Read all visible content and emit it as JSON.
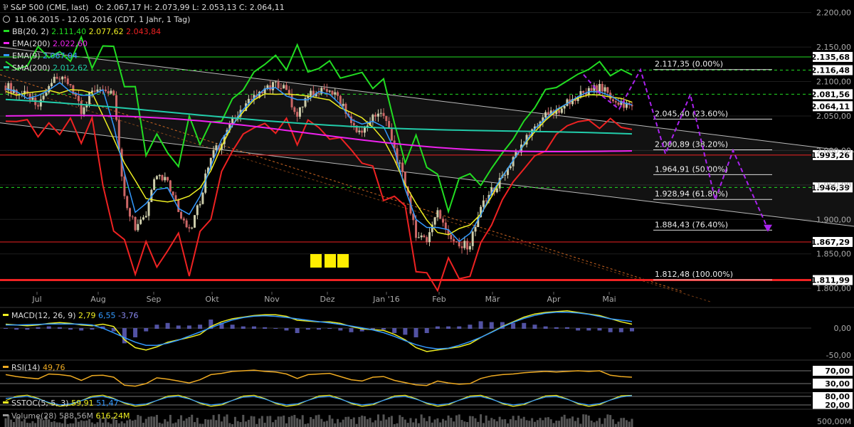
{
  "header": {
    "logo_text": "⅌",
    "title": "S&P 500 (CME, last)",
    "ohlc": "O: 2.067,17  H: 2.073,99  L: 2.053,13  C: 2.064,11",
    "period": "11.06.2015 - 12.05.2016 (CDT, 1 Jahr, 1 Tag)",
    "indicators": [
      {
        "label": "BB(20, 2)",
        "values": [
          "2.111,40",
          "2.077,62",
          "2.043,84"
        ],
        "colors": [
          "#22dd22",
          "#eeee22",
          "#ee2222"
        ],
        "swatch": "#22dd22"
      },
      {
        "label": "EMA(200)",
        "values": [
          "2.022,60"
        ],
        "colors": [
          "#ee22ee"
        ],
        "swatch": "#ee22ee"
      },
      {
        "label": "EMA(9)",
        "values": [
          "2.067,04"
        ],
        "colors": [
          "#3399ff"
        ],
        "swatch": "#3399ff"
      },
      {
        "label": "SMA(200)",
        "values": [
          "2.012,62"
        ],
        "colors": [
          "#22ccaa"
        ],
        "swatch": "#22ccaa"
      }
    ]
  },
  "chart_data": {
    "type": "candlestick",
    "y_range": [
      1795,
      2212
    ],
    "y_ticks": [
      "2.200,00",
      "2.150,00",
      "2.100,00",
      "2.050,00",
      "2.000,00",
      "1.950,00",
      "1.900,00",
      "1.850,00",
      "1.800,00"
    ],
    "y_tick_values": [
      2200,
      2150,
      2100,
      2050,
      2000,
      1950,
      1900,
      1850,
      1800
    ],
    "x_ticks": [
      "Jul",
      "Aug",
      "Sep",
      "Okt",
      "Nov",
      "Dez",
      "Jan '16",
      "Feb",
      "Mär",
      "Apr",
      "Mai"
    ],
    "close": [
      2094,
      2085,
      2078,
      2063,
      2098,
      2102,
      2095,
      2058,
      2087,
      2095,
      2082,
      1931,
      1890,
      1910,
      1969,
      1951,
      1917,
      1880,
      1925,
      1996,
      2010,
      2042,
      2057,
      2080,
      2090,
      2098,
      2085,
      2054,
      2082,
      2084,
      2090,
      2070,
      2040,
      2025,
      2050,
      2052,
      2001,
      1950,
      1880,
      1870,
      1915,
      1880,
      1860,
      1864,
      1915,
      1940,
      1960,
      1986,
      2011,
      2030,
      2053,
      2055,
      2070,
      2079,
      2085,
      2092,
      2078,
      2068,
      2064
    ],
    "levels": [
      {
        "value": 2135.68,
        "label": "2.135,68",
        "color": "#22dd22",
        "style": "solid"
      },
      {
        "value": 2116.48,
        "label": "2.116,48",
        "color": "#22dd22",
        "style": "dashed"
      },
      {
        "value": 2081.56,
        "label": "2.081,56",
        "color": "#22dd22",
        "style": "dashed"
      },
      {
        "value": 2064.11,
        "label": "2.064,11",
        "color": "#ffffff",
        "style": "none"
      },
      {
        "value": 1993.26,
        "label": "1.993,26",
        "color": "#ee2222",
        "style": "solid"
      },
      {
        "value": 1946.39,
        "label": "1.946,39",
        "color": "#22dd22",
        "style": "dashed"
      },
      {
        "value": 1867.29,
        "label": "1.867,29",
        "color": "#ee2222",
        "style": "solid"
      },
      {
        "value": 1811.99,
        "label": "1.811,99",
        "color": "#ee2222",
        "style": "thick"
      }
    ],
    "fibonacci": [
      {
        "value": 2117.35,
        "label": "2.117,35 (0.00%)"
      },
      {
        "value": 2045.4,
        "label": "2.045,40 (23.60%)"
      },
      {
        "value": 2000.89,
        "label": "2.000,89 (38.20%)"
      },
      {
        "value": 1964.91,
        "label": "1.964,91 (50.00%)"
      },
      {
        "value": 1928.94,
        "label": "1.928,94 (61.80%)"
      },
      {
        "value": 1884.43,
        "label": "1.884,43 (76.40%)"
      },
      {
        "value": 1812.48,
        "label": "1.812,48 (100.00%)"
      }
    ],
    "colors": {
      "bb": "#22dd22",
      "bb_mid": "#eeee22",
      "bb_low": "#ee2222",
      "ema200": "#ee22ee",
      "ema9": "#3399ff",
      "sma200": "#22ccaa",
      "up": "#ccccaa",
      "down": "#cc6666",
      "projection": "#aa22ee",
      "marker": "#ffee00"
    }
  },
  "macd": {
    "label": "MACD(12, 26, 9)",
    "value": "2,79",
    "signal": "6,55",
    "hist": "-3,76",
    "ticks": [
      "0,00",
      "-50,00"
    ],
    "series": [
      5,
      4,
      3,
      4,
      6,
      7,
      6,
      4,
      3,
      5,
      2,
      -15,
      -25,
      -28,
      -24,
      -18,
      -15,
      -12,
      -8,
      2,
      8,
      12,
      14,
      16,
      17,
      17,
      15,
      10,
      9,
      8,
      8,
      6,
      2,
      -1,
      -2,
      -3,
      -8,
      -15,
      -25,
      -30,
      -28,
      -26,
      -24,
      -20,
      -12,
      -5,
      2,
      8,
      14,
      18,
      20,
      21,
      22,
      20,
      18,
      16,
      12,
      8,
      5
    ]
  },
  "rsi": {
    "label": "RSI(14)",
    "value": "49,76",
    "ticks": [
      "70,00",
      "30,00"
    ],
    "series": [
      58,
      52,
      48,
      45,
      60,
      58,
      54,
      40,
      55,
      56,
      50,
      25,
      22,
      30,
      48,
      44,
      38,
      32,
      42,
      58,
      62,
      68,
      70,
      72,
      68,
      66,
      60,
      46,
      58,
      60,
      62,
      52,
      42,
      38,
      50,
      52,
      40,
      33,
      26,
      24,
      38,
      32,
      28,
      30,
      46,
      54,
      58,
      60,
      64,
      66,
      68,
      66,
      68,
      70,
      68,
      70,
      56,
      52,
      50
    ]
  },
  "sstoc": {
    "label": "SSTOC(5, 5, 3)",
    "value1": "59,91",
    "value2": "51,47",
    "ticks": [
      "80,00",
      "20,00"
    ]
  },
  "volume": {
    "label": "Volume(28)",
    "value1": "588,56M",
    "value2": "616,24M",
    "tick": "500,00M"
  }
}
